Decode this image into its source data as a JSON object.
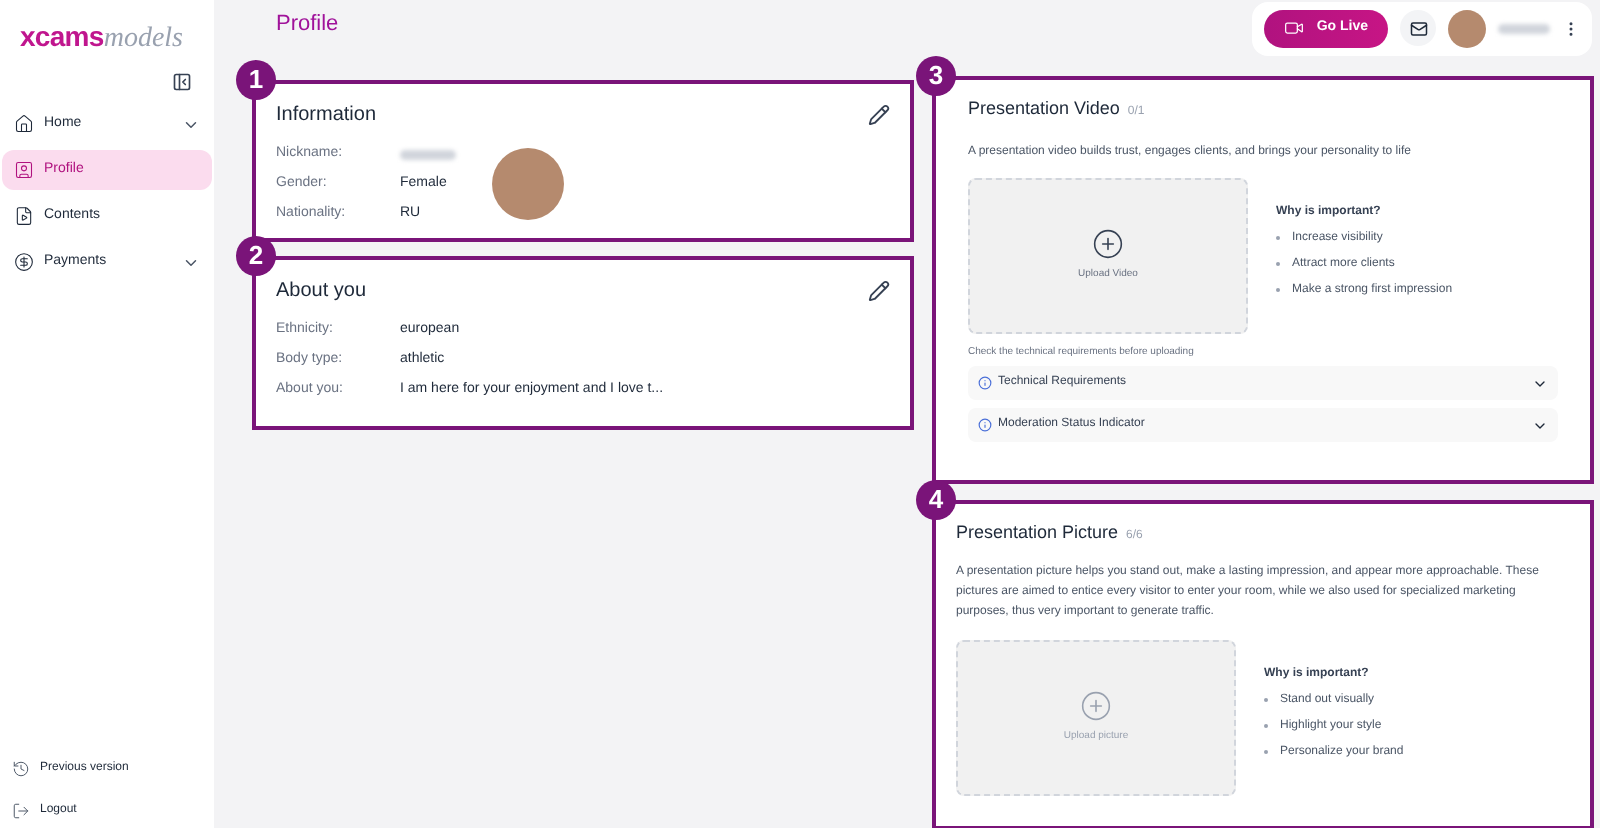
{
  "sidebar": {
    "logo_main": "xcams",
    "logo_sub": "models",
    "items": [
      {
        "kind": "home",
        "label": "Home",
        "selected": false,
        "expandable": true
      },
      {
        "kind": "profile",
        "label": "Profile",
        "selected": true,
        "expandable": false
      },
      {
        "kind": "contents",
        "label": "Contents",
        "selected": false,
        "expandable": false
      },
      {
        "kind": "payments",
        "label": "Payments",
        "selected": false,
        "expandable": true
      }
    ],
    "footer_items": [
      {
        "kind": "history",
        "label": "Previous version"
      },
      {
        "kind": "logout",
        "label": "Logout"
      }
    ]
  },
  "header": {
    "title": "Profile",
    "go_live": "Go Live"
  },
  "information": {
    "badge": "1",
    "title": "Information",
    "fields": [
      {
        "label": "Nickname:"
      },
      {
        "label": "Gender:",
        "value": "Female"
      },
      {
        "label": "Nationality:",
        "value": "RU"
      }
    ]
  },
  "about": {
    "badge": "2",
    "title": "About you",
    "fields": [
      {
        "label": "Ethnicity:",
        "value": "european"
      },
      {
        "label": "Body type:",
        "value": "athletic"
      },
      {
        "label": "About you:",
        "value": "I am here for your enjoyment and I love t..."
      }
    ]
  },
  "video": {
    "badge": "3",
    "title": "Presentation Video",
    "count": "0/1",
    "description": "A presentation video builds trust, engages clients, and brings your personality to life",
    "upload_label": "Upload Video",
    "why_title": "Why is important?",
    "reasons": [
      "Increase visibility",
      "Attract more clients",
      "Make a strong first impression"
    ],
    "note": "Check the technical requirements before uploading",
    "accordions": [
      {
        "label": "Technical Requirements",
        "expanded": false
      },
      {
        "label": "Moderation Status Indicator",
        "expanded": false
      }
    ]
  },
  "picture": {
    "badge": "4",
    "title": "Presentation Picture",
    "count": "6/6",
    "description": "A presentation picture helps you stand out, make a lasting impression, and appear more approachable. These pictures are aimed to entice every visitor to enter your room, while we also used for specialized marketing purposes, thus very important to generate traffic.",
    "upload_label": "Upload picture",
    "why_title": "Why is important?",
    "reasons": [
      "Stand out visually",
      "Highlight your style",
      "Personalize your brand"
    ]
  }
}
